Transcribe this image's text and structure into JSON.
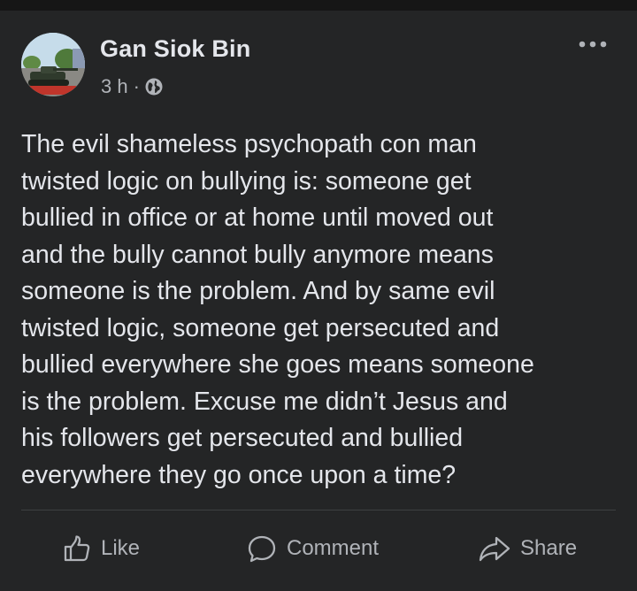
{
  "post": {
    "author": "Gan Siok Bin",
    "time": "3 h",
    "separator": "·",
    "privacy_icon": "globe-icon",
    "text": "The evil shameless psychopath con man\ntwisted logic on bullying is: someone get\nbullied in office or at home until moved out\nand the bully cannot bully anymore means\nsomeone is the problem. And by same evil\ntwisted logic, someone get persecuted and\nbullied everywhere she goes means someone\nis the problem. Excuse me didn’t Jesus and\nhis followers get persecuted and bullied\neverywhere they go once upon a time?"
  },
  "actions": {
    "like": "Like",
    "comment": "Comment",
    "share": "Share"
  },
  "colors": {
    "background": "#242526",
    "text_primary": "#e4e6eb",
    "text_secondary": "#b0b3b8",
    "divider": "#3e4042"
  }
}
